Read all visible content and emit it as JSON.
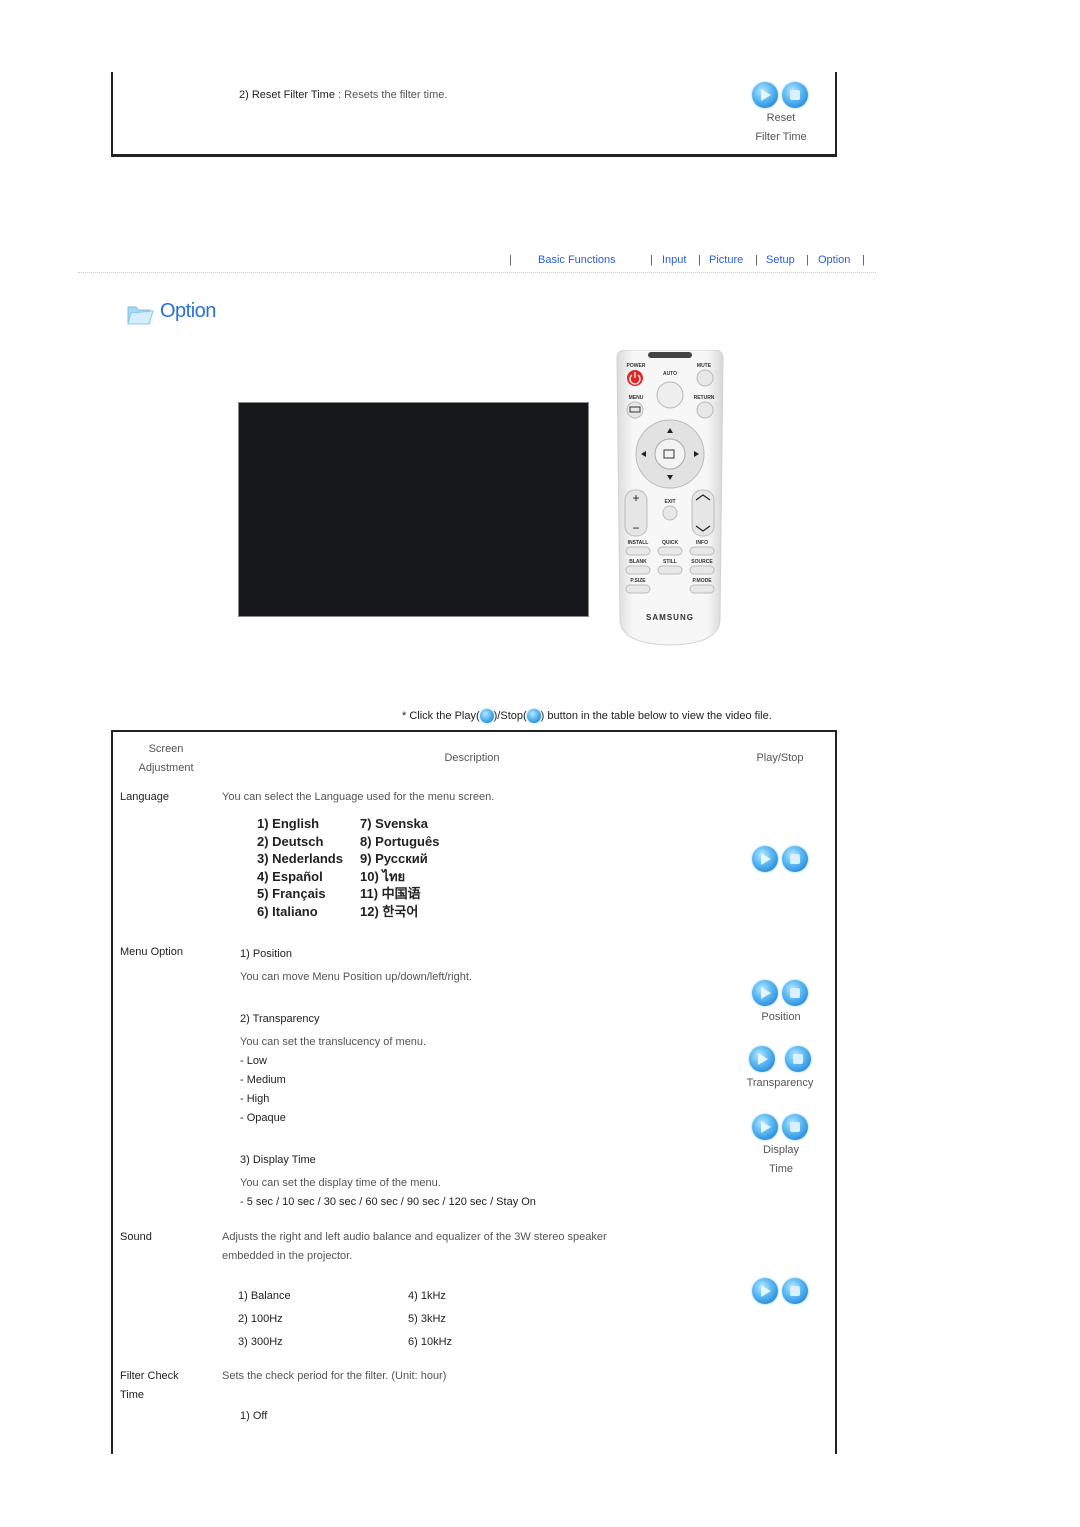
{
  "top_section": {
    "item_title": "2) Reset Filter Time",
    "item_sep": " : ",
    "item_desc": "Resets the filter time.",
    "caption_line1": "Reset",
    "caption_line2": "Filter Time"
  },
  "nav": {
    "items": [
      {
        "label": "Basic Functions"
      },
      {
        "label": "Input"
      },
      {
        "label": "Picture"
      },
      {
        "label": "Setup"
      },
      {
        "label": "Option"
      }
    ],
    "separator": "|"
  },
  "page_title": "Option",
  "remote": {
    "brand": "SAMSUNG",
    "labels": [
      "POWER",
      "MUTE",
      "AUTO",
      "MENU",
      "RETURN",
      "EXIT",
      "VOL",
      "INSTALL",
      "QUICK",
      "INFO",
      "BLANK",
      "STILL",
      "SOURCE",
      "P.SIZE",
      "P.MODE"
    ]
  },
  "instruction": {
    "prefix": "* Click the Play(",
    "middle": ")/Stop(",
    "suffix": ") button in the table below to view the video file."
  },
  "table": {
    "headers": {
      "col1_line1": "Screen",
      "col1_line2": "Adjustment",
      "col2": "Description",
      "col3": "Play/Stop"
    },
    "language": {
      "label": "Language",
      "desc": "You can select the Language used for the menu screen.",
      "options_left": [
        "1) English",
        "2) Deutsch",
        "3) Nederlands",
        "4) Español",
        "5) Français",
        "6) Italiano"
      ],
      "options_right": [
        "7) Svenska",
        "8) Português",
        "9) Русский",
        "10) ไทย",
        "11) 中国语",
        "12) 한국어"
      ]
    },
    "menu_option": {
      "label": "Menu Option",
      "position_title": "1) Position",
      "position_desc": "You can move Menu Position up/down/left/right.",
      "transparency_title": "2) Transparency",
      "transparency_desc": "You can set the translucency of menu.",
      "transparency_options": [
        "- Low",
        "- Medium",
        "- High",
        "- Opaque"
      ],
      "display_title": "3) Display Time",
      "display_desc": "You can set the display time of the menu.",
      "display_options": "- 5 sec / 10 sec / 30 sec / 60 sec / 90 sec / 120 sec / Stay On",
      "captions": {
        "position": "Position",
        "transparency": "Transparency",
        "display_line1": "Display",
        "display_line2": "Time"
      }
    },
    "sound": {
      "label": "Sound",
      "desc_line1": "Adjusts the right and left audio balance and equalizer of the 3W stereo speaker",
      "desc_line2": "embedded in the projector.",
      "options_left": [
        "1) Balance",
        "2) 100Hz",
        "3) 300Hz"
      ],
      "options_right": [
        "4) 1kHz",
        "5) 3kHz",
        "6) 10kHz"
      ]
    },
    "filter_check": {
      "label_line1": "Filter Check",
      "label_line2": "Time",
      "desc": "Sets the check period for the filter. (Unit: hour)",
      "options": [
        "1) Off"
      ]
    }
  },
  "colors": {
    "link": "#2b5ed8",
    "title": "#2b6fd8",
    "play_button": "#3b9be6"
  }
}
